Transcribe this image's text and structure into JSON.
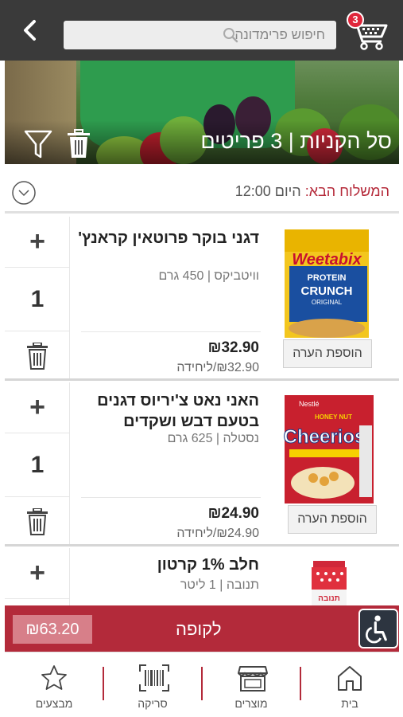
{
  "header": {
    "search_placeholder": "חיפוש פרימדונה",
    "cart_count": "3"
  },
  "hero": {
    "title": "סל הקניות | 3 פריטים"
  },
  "delivery": {
    "label": "המשלוח הבא:",
    "value": "היום 12:00"
  },
  "items": [
    {
      "name": "דגני בוקר פרוטאין קראנץ'",
      "meta": "וויטביקס | 450 גרם",
      "qty": "1",
      "price": "₪32.90",
      "unit_price": "₪32.90/ליחידה",
      "note_label": "הוספת הערה",
      "image_brand": "Weetabix",
      "image_sub": "PROTEIN",
      "image_crunch": "CRUNCH",
      "image_orig": "ORIGINAL"
    },
    {
      "name": "האני נאט צ'יריוס דגנים בטעם דבש ושקדים",
      "meta": "נסטלה | 625 גרם",
      "qty": "1",
      "price": "₪24.90",
      "unit_price": "₪24.90/ליחידה",
      "note_label": "הוספת הערה",
      "image_brand": "Cheerios",
      "image_maker": "Nestlé",
      "image_honey": "HONEY NUT"
    },
    {
      "name": "חלב 1% קרטון",
      "meta": "תנובה | 1 ליטר",
      "image_brand": "תנובה"
    }
  ],
  "checkout": {
    "total": "₪63.20",
    "label": "לקופה"
  },
  "nav": {
    "home": "בית",
    "products": "מוצרים",
    "scan": "סריקה",
    "deals": "מבצעים"
  },
  "colors": {
    "brand_red": "#b32a3a",
    "topbar": "#3a3a3a",
    "badge": "#e0263b"
  }
}
